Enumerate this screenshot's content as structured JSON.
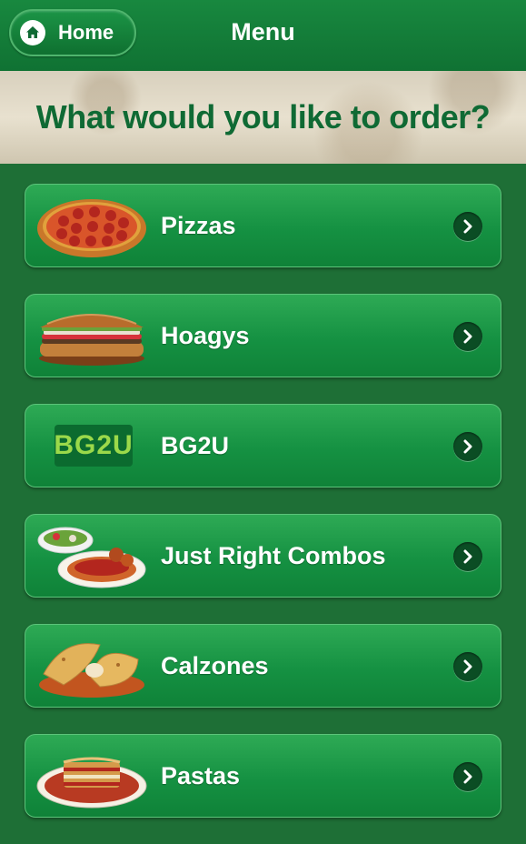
{
  "header": {
    "home_label": "Home",
    "title": "Menu"
  },
  "banner": {
    "text": "What would you like to order?"
  },
  "menu": {
    "items": [
      {
        "label": "Pizzas",
        "image": "pizza-image"
      },
      {
        "label": "Hoagys",
        "image": "hoagie-image"
      },
      {
        "label": "BG2U",
        "image": "bg2u-logo",
        "logo_text": "BG2U"
      },
      {
        "label": "Just Right Combos",
        "image": "combo-image"
      },
      {
        "label": "Calzones",
        "image": "calzone-image"
      },
      {
        "label": "Pastas",
        "image": "pasta-image"
      }
    ]
  },
  "colors": {
    "background": "#1e6f36",
    "button_green": "#159142",
    "banner_text": "#0f6a34",
    "chevron_bg": "#0b4d24"
  }
}
